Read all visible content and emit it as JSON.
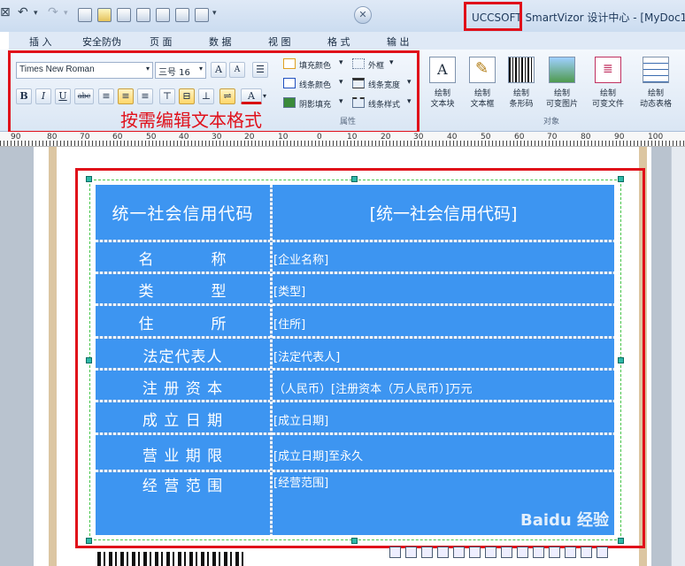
{
  "window": {
    "title": "UCCSOFT SmartVizor 设计中心 - [MyDoc1]"
  },
  "menu_tabs": [
    "插 入",
    "安全防伪",
    "页 面",
    "数 据",
    "视 图",
    "格 式",
    "输 出"
  ],
  "ribbon": {
    "font_name": "Times New Roman",
    "font_size": "三号 16",
    "grow_font": "A",
    "shrink_font": "A",
    "bold": "B",
    "italic": "I",
    "underline": "U",
    "strike": "abc",
    "font_color_glyph": "A",
    "fill_color_label": "填充颜色",
    "line_color_label": "线条颜色",
    "shadow_fill_label": "阴影填充",
    "border_label": "外框",
    "line_width_label": "线条宽度",
    "line_style_label": "线条样式",
    "group_properties": "属性",
    "group_objects": "对象",
    "draw_buttons": [
      {
        "line1": "绘制",
        "line2": "文本块",
        "icon": "text-block-icon"
      },
      {
        "line1": "绘制",
        "line2": "文本框",
        "icon": "text-box-icon"
      },
      {
        "line1": "绘制",
        "line2": "条形码",
        "icon": "barcode-icon"
      },
      {
        "line1": "绘制",
        "line2": "可变图片",
        "icon": "picture-icon"
      },
      {
        "line1": "绘制",
        "line2": "可变文件",
        "icon": "file-icon"
      },
      {
        "line1": "绘制",
        "line2": "动态表格",
        "icon": "table-icon"
      }
    ]
  },
  "annotation": "按需编辑文本格式",
  "ruler": {
    "labels": [
      "90",
      "80",
      "70",
      "60",
      "50",
      "40",
      "30",
      "20",
      "10",
      "0",
      "10",
      "20",
      "30",
      "40",
      "50",
      "60",
      "70",
      "80",
      "90",
      "100"
    ]
  },
  "table": {
    "header_left": "统一社会信用代码",
    "header_right": "[统一社会信用代码]",
    "rows": [
      {
        "label": "名          称",
        "value": "[企业名称]"
      },
      {
        "label": "类          型",
        "value": "[类型]"
      },
      {
        "label": "住          所",
        "value": "[住所]"
      },
      {
        "label": "法定代表人",
        "value": "[法定代表人]"
      },
      {
        "label": "注 册 资 本",
        "value": "（人民币）[注册资本（万人民币）]万元"
      },
      {
        "label": "成 立 日 期",
        "value": "[成立日期]"
      },
      {
        "label": "营 业 期 限",
        "value": "[成立日期]至永久"
      },
      {
        "label": "经 营 范 围",
        "value": "[经营范围]"
      }
    ]
  },
  "watermark": "Baidu 经验",
  "colors": {
    "table_fill": "#3d95f1",
    "highlight": "#e0101a",
    "handle": "#2fb8a8"
  }
}
